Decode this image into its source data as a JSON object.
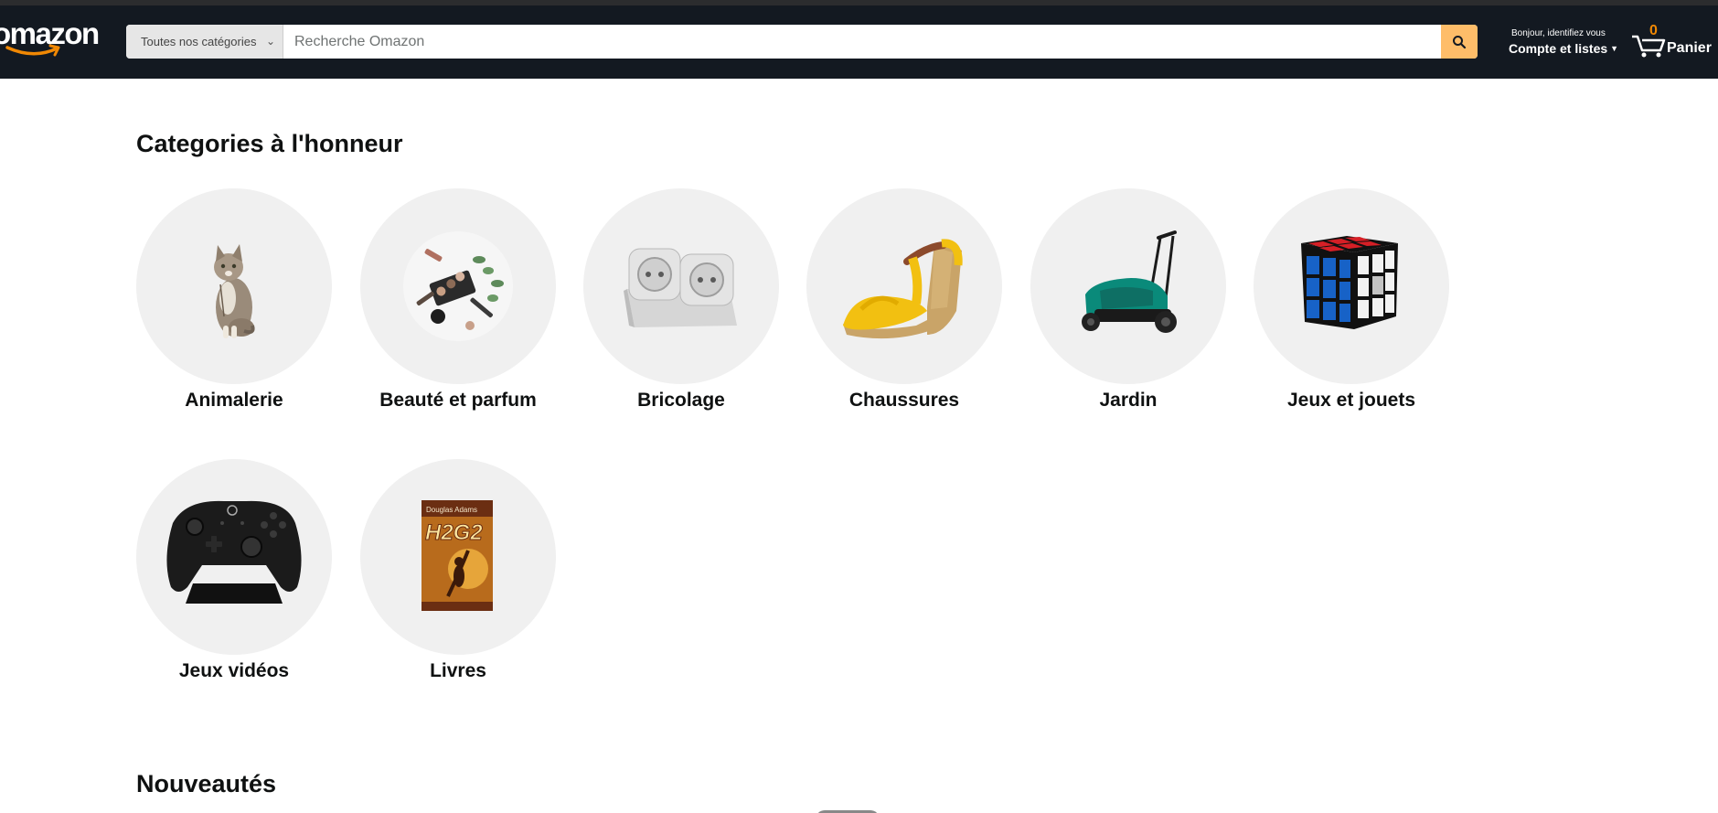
{
  "header": {
    "logo_text": "omazon",
    "search": {
      "category_selected": "Toutes nos catégories",
      "placeholder": "Recherche Omazon"
    },
    "account": {
      "greeting": "Bonjour, identifiez vous",
      "lists_label": "Compte et listes"
    },
    "cart": {
      "count": "0",
      "label": "Panier"
    }
  },
  "featured": {
    "title": "Categories à l'honneur",
    "categories": [
      {
        "label": "Animalerie",
        "icon": "cat-image"
      },
      {
        "label": "Beauté et parfum",
        "icon": "makeup-image"
      },
      {
        "label": "Bricolage",
        "icon": "power-socket-image"
      },
      {
        "label": "Chaussures",
        "icon": "sandal-image"
      },
      {
        "label": "Jardin",
        "icon": "lawnmower-image"
      },
      {
        "label": "Jeux et jouets",
        "icon": "rubiks-cube-image"
      },
      {
        "label": "Jeux vidéos",
        "icon": "game-controller-image"
      },
      {
        "label": "Livres",
        "icon": "book-cover-image",
        "book_author": "Douglas Adams",
        "book_title": "H2G2"
      }
    ]
  },
  "new_arrivals": {
    "title": "Nouveautés"
  }
}
